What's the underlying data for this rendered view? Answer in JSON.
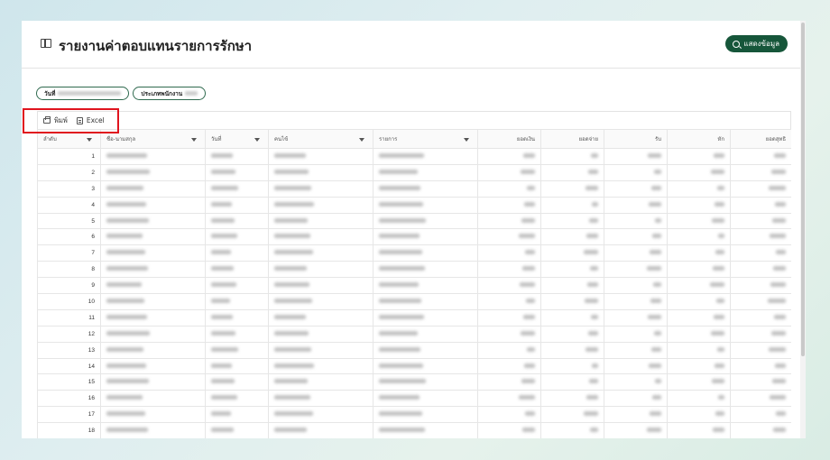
{
  "header": {
    "title": "รายงานค่าตอบแทนรายการรักษา",
    "show_button": "แสดงข้อมูล"
  },
  "filters": [
    {
      "label": "วันที่"
    },
    {
      "label": "ประเภทพนักงาน"
    }
  ],
  "toolbar": {
    "print_label": "พิมพ์",
    "excel_label": "Excel"
  },
  "table": {
    "columns": [
      "ลำดับ",
      "ชื่อ-นามสกุล",
      "วันที่",
      "คนไข้",
      "รายการ",
      "ยอดเงิน",
      "ยอดจ่าย",
      "รับ",
      "หัก",
      "ยอดสุทธิ"
    ],
    "rows": [
      "1",
      "2",
      "3",
      "4",
      "5",
      "6",
      "7",
      "8",
      "9",
      "10",
      "11",
      "12",
      "13",
      "14",
      "15",
      "16",
      "17",
      "18"
    ]
  },
  "colors": {
    "accent": "#16563a",
    "highlight": "#e0141e"
  }
}
